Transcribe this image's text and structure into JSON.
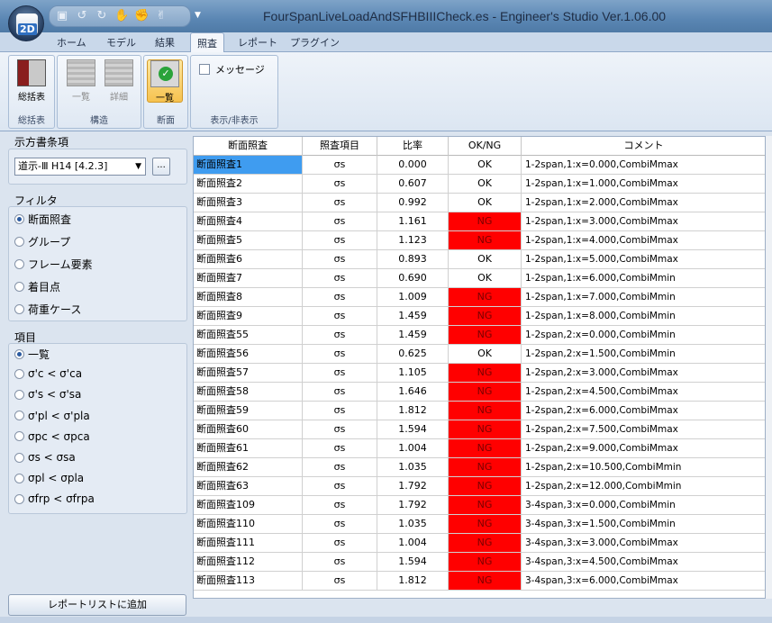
{
  "app": {
    "title": "FourSpanLiveLoadAndSFHBIIICheck.es - Engineer's Studio Ver.1.06.00",
    "orb_text": "2D"
  },
  "tabs": [
    "ホーム",
    "モデル",
    "結果",
    "照査",
    "レポート",
    "プラグイン"
  ],
  "active_tab": "照査",
  "ribbon": {
    "groups": [
      {
        "label": "総括表",
        "buttons": [
          {
            "label": "総括表"
          }
        ]
      },
      {
        "label": "構造",
        "buttons": [
          {
            "label": "一覧"
          },
          {
            "label": "詳細"
          }
        ]
      },
      {
        "label": "断面",
        "buttons": [
          {
            "label": "一覧"
          }
        ]
      },
      {
        "label": "表示/非表示",
        "checkbox": "メッセージ"
      }
    ]
  },
  "left_panel": {
    "spec_title": "示方書条項",
    "spec_value": "道示-Ⅲ H14 [4.2.3]",
    "spec_more": "...",
    "filter_title": "フィルタ",
    "filters": [
      "断面照査",
      "グループ",
      "フレーム要素",
      "着目点",
      "荷重ケース"
    ],
    "filter_selected": 0,
    "items_title": "項目",
    "items": [
      "一覧",
      "σ'c < σ'ca",
      "σ's < σ'sa",
      "σ'pl < σ'pla",
      "σpc < σpca",
      "σs < σsa",
      "σpl < σpla",
      "σfrp < σfrpa"
    ],
    "item_selected": 0,
    "add_report": "レポートリストに追加"
  },
  "table": {
    "headers": [
      "断面照査",
      "照査項目",
      "比率",
      "OK/NG",
      "コメント"
    ],
    "colors": {
      "ng": "#ff0000",
      "selected": "#3f9cf0"
    },
    "rows": [
      {
        "name": "断面照査1",
        "item": "σs",
        "ratio": "0.000",
        "status": "OK",
        "comment": "1-2span,1:x=0.000,CombiMmax"
      },
      {
        "name": "断面照査2",
        "item": "σs",
        "ratio": "0.607",
        "status": "OK",
        "comment": "1-2span,1:x=1.000,CombiMmax"
      },
      {
        "name": "断面照査3",
        "item": "σs",
        "ratio": "0.992",
        "status": "OK",
        "comment": "1-2span,1:x=2.000,CombiMmax"
      },
      {
        "name": "断面照査4",
        "item": "σs",
        "ratio": "1.161",
        "status": "NG",
        "comment": "1-2span,1:x=3.000,CombiMmax"
      },
      {
        "name": "断面照査5",
        "item": "σs",
        "ratio": "1.123",
        "status": "NG",
        "comment": "1-2span,1:x=4.000,CombiMmax"
      },
      {
        "name": "断面照査6",
        "item": "σs",
        "ratio": "0.893",
        "status": "OK",
        "comment": "1-2span,1:x=5.000,CombiMmax"
      },
      {
        "name": "断面照査7",
        "item": "σs",
        "ratio": "0.690",
        "status": "OK",
        "comment": "1-2span,1:x=6.000,CombiMmin"
      },
      {
        "name": "断面照査8",
        "item": "σs",
        "ratio": "1.009",
        "status": "NG",
        "comment": "1-2span,1:x=7.000,CombiMmin"
      },
      {
        "name": "断面照査9",
        "item": "σs",
        "ratio": "1.459",
        "status": "NG",
        "comment": "1-2span,1:x=8.000,CombiMmin"
      },
      {
        "name": "断面照査55",
        "item": "σs",
        "ratio": "1.459",
        "status": "NG",
        "comment": "1-2span,2:x=0.000,CombiMmin"
      },
      {
        "name": "断面照査56",
        "item": "σs",
        "ratio": "0.625",
        "status": "OK",
        "comment": "1-2span,2:x=1.500,CombiMmin"
      },
      {
        "name": "断面照査57",
        "item": "σs",
        "ratio": "1.105",
        "status": "NG",
        "comment": "1-2span,2:x=3.000,CombiMmax"
      },
      {
        "name": "断面照査58",
        "item": "σs",
        "ratio": "1.646",
        "status": "NG",
        "comment": "1-2span,2:x=4.500,CombiMmax"
      },
      {
        "name": "断面照査59",
        "item": "σs",
        "ratio": "1.812",
        "status": "NG",
        "comment": "1-2span,2:x=6.000,CombiMmax"
      },
      {
        "name": "断面照査60",
        "item": "σs",
        "ratio": "1.594",
        "status": "NG",
        "comment": "1-2span,2:x=7.500,CombiMmax"
      },
      {
        "name": "断面照査61",
        "item": "σs",
        "ratio": "1.004",
        "status": "NG",
        "comment": "1-2span,2:x=9.000,CombiMmax"
      },
      {
        "name": "断面照査62",
        "item": "σs",
        "ratio": "1.035",
        "status": "NG",
        "comment": "1-2span,2:x=10.500,CombiMmin"
      },
      {
        "name": "断面照査63",
        "item": "σs",
        "ratio": "1.792",
        "status": "NG",
        "comment": "1-2span,2:x=12.000,CombiMmin"
      },
      {
        "name": "断面照査109",
        "item": "σs",
        "ratio": "1.792",
        "status": "NG",
        "comment": "3-4span,3:x=0.000,CombiMmin"
      },
      {
        "name": "断面照査110",
        "item": "σs",
        "ratio": "1.035",
        "status": "NG",
        "comment": "3-4span,3:x=1.500,CombiMmin"
      },
      {
        "name": "断面照査111",
        "item": "σs",
        "ratio": "1.004",
        "status": "NG",
        "comment": "3-4span,3:x=3.000,CombiMmax"
      },
      {
        "name": "断面照査112",
        "item": "σs",
        "ratio": "1.594",
        "status": "NG",
        "comment": "3-4span,3:x=4.500,CombiMmax"
      },
      {
        "name": "断面照査113",
        "item": "σs",
        "ratio": "1.812",
        "status": "NG",
        "comment": "3-4span,3:x=6.000,CombiMmax"
      }
    ],
    "selected_row": 0
  }
}
